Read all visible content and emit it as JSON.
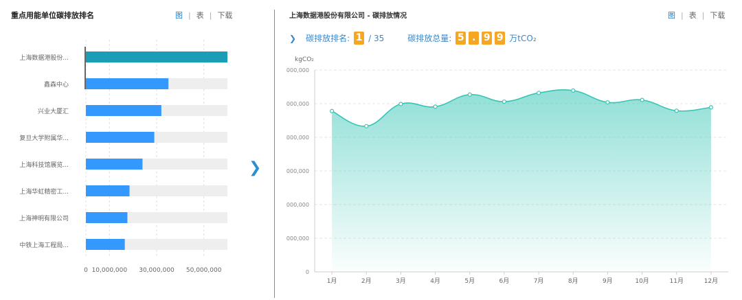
{
  "left_panel": {
    "title": "重点用能单位碳排放排名",
    "tabs": [
      "图",
      "表",
      "下载"
    ],
    "rows": [
      {
        "label": "上海数据港股份...",
        "value": 60000000
      },
      {
        "label": "鑫森中心",
        "value": 35000000
      },
      {
        "label": "兴业大厦汇",
        "value": 32000000
      },
      {
        "label": "复旦大学附属华...",
        "value": 29000000
      },
      {
        "label": "上海科技馆展览...",
        "value": 24000000
      },
      {
        "label": "上海华虹精密工...",
        "value": 18500000
      },
      {
        "label": "上海神明有限公司",
        "value": 17600000
      },
      {
        "label": "中铁上海工程局...",
        "value": 16500000
      }
    ],
    "x_ticks": [
      "0",
      "10,000,000",
      "30,000,000",
      "50,000,000"
    ]
  },
  "right_panel": {
    "title": "上海数据港股份有限公司 - 碳排放情况",
    "tabs": [
      "图",
      "表",
      "下载"
    ],
    "rank_label": "碳排放排名:",
    "rank_value": "1",
    "rank_total": "/ 35",
    "total_label": "碳排放总量:",
    "total_digits": [
      "5",
      ".",
      "9",
      "9"
    ],
    "total_unit": "万tCO₂"
  },
  "nav": {
    "next_icon": "chevron-right-icon"
  },
  "colors": {
    "accent": "#2a7fc8",
    "bar_top": "#1a9db5",
    "bar": "#3399ff",
    "track": "#eeeeee",
    "line": "#35c5b5",
    "digit_bg": "#f5a623"
  },
  "chart_data": {
    "type": "area",
    "ylabel": "kgCO₂",
    "x": [
      "1月",
      "2月",
      "3月",
      "4月",
      "5月",
      "6月",
      "7月",
      "8月",
      "9月",
      "10月",
      "11月",
      "12月"
    ],
    "y_tick_labels": [
      "0",
      "000,000",
      "000,000",
      "000,000",
      "000,000",
      "000,000",
      "000,000"
    ],
    "y_tick_values": [
      0,
      1,
      2,
      3,
      4,
      5,
      6
    ],
    "values": [
      4.78,
      4.33,
      4.99,
      4.91,
      5.27,
      5.06,
      5.32,
      5.39,
      5.04,
      5.11,
      4.79,
      4.89
    ],
    "ylim": [
      0,
      6
    ],
    "grid": true
  }
}
